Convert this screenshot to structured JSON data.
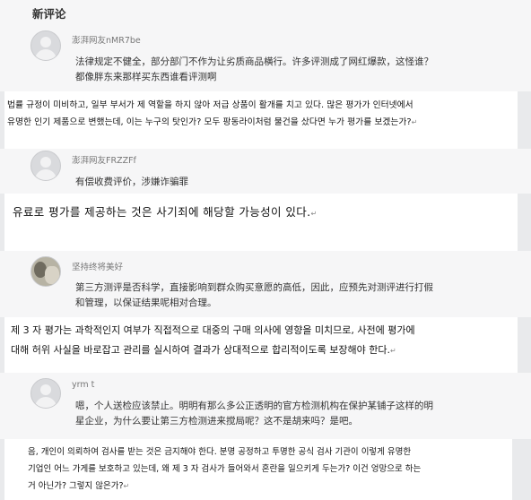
{
  "section_title": "新评论",
  "comments": [
    {
      "username": "澎湃网友nMR7be",
      "cn_lines": [
        "法律规定不健全，部分部门不作为让劣质商品横行。许多评测成了网红爆款，这怪谁？",
        "都像胖东来那样买东西谁看评测啊"
      ],
      "ko_lines": [
        "법률 규정이 미비하고, 일부 부서가 제 역할을 하지 않아 저급 상품이 활개를 치고 있다. 많은 평가가 인터넷에서",
        "유명한 인기 제품으로 변했는데, 이는 누구의 탓인가? 모두 팡동라이처럼 물건을 샀다면 누가 평가를 보겠는가?"
      ]
    },
    {
      "username": "澎湃网友FRZZFf",
      "cn_lines": [
        "有偿收费评价，涉嫌诈骗罪"
      ],
      "ko_lines": [
        "유료로 평가를 제공하는 것은 사기죄에 해당할 가능성이 있다."
      ]
    },
    {
      "username": "坚持终将美好",
      "cn_lines": [
        "第三方测评是否科学，直接影响到群众购买意愿的高低，因此，应预先对测评进行打假",
        "和管理，以保证结果呢相对合理。"
      ],
      "ko_lines": [
        "제 3 자 평가는 과학적인지 여부가 직접적으로 대중의 구매 의사에 영향을 미치므로, 사전에 평가에",
        "대해 허위 사실을 바로잡고 관리를 실시하여 결과가 상대적으로 합리적이도록 보장해야 한다."
      ]
    },
    {
      "username": "yrm t",
      "cn_lines": [
        "嗯，个人送检应该禁止。明明有那么多公正透明的官方检测机构在保护某铺子这样的明",
        "星企业，为什么要让第三方检测进来搅局呢？这不是胡来吗？是吧。"
      ],
      "ko_lines": [
        "음, 개인이 의뢰하여 검사를 받는 것은 금지해야 한다. 분명 공정하고 투명한 공식 검사 기관이 이렇게 유명한",
        "기업인 어느 가게를 보호하고 있는데, 왜 제 3 자 검사가 들어와서 혼란을 일으키게 두는가? 이건 엉망으로 하는",
        "거 아닌가? 그렇지 않은가?"
      ]
    }
  ],
  "icons": {
    "return_mark": "↵",
    "avatar": "default-avatar-icon",
    "avatar_photo": "user-photo-avatar"
  }
}
